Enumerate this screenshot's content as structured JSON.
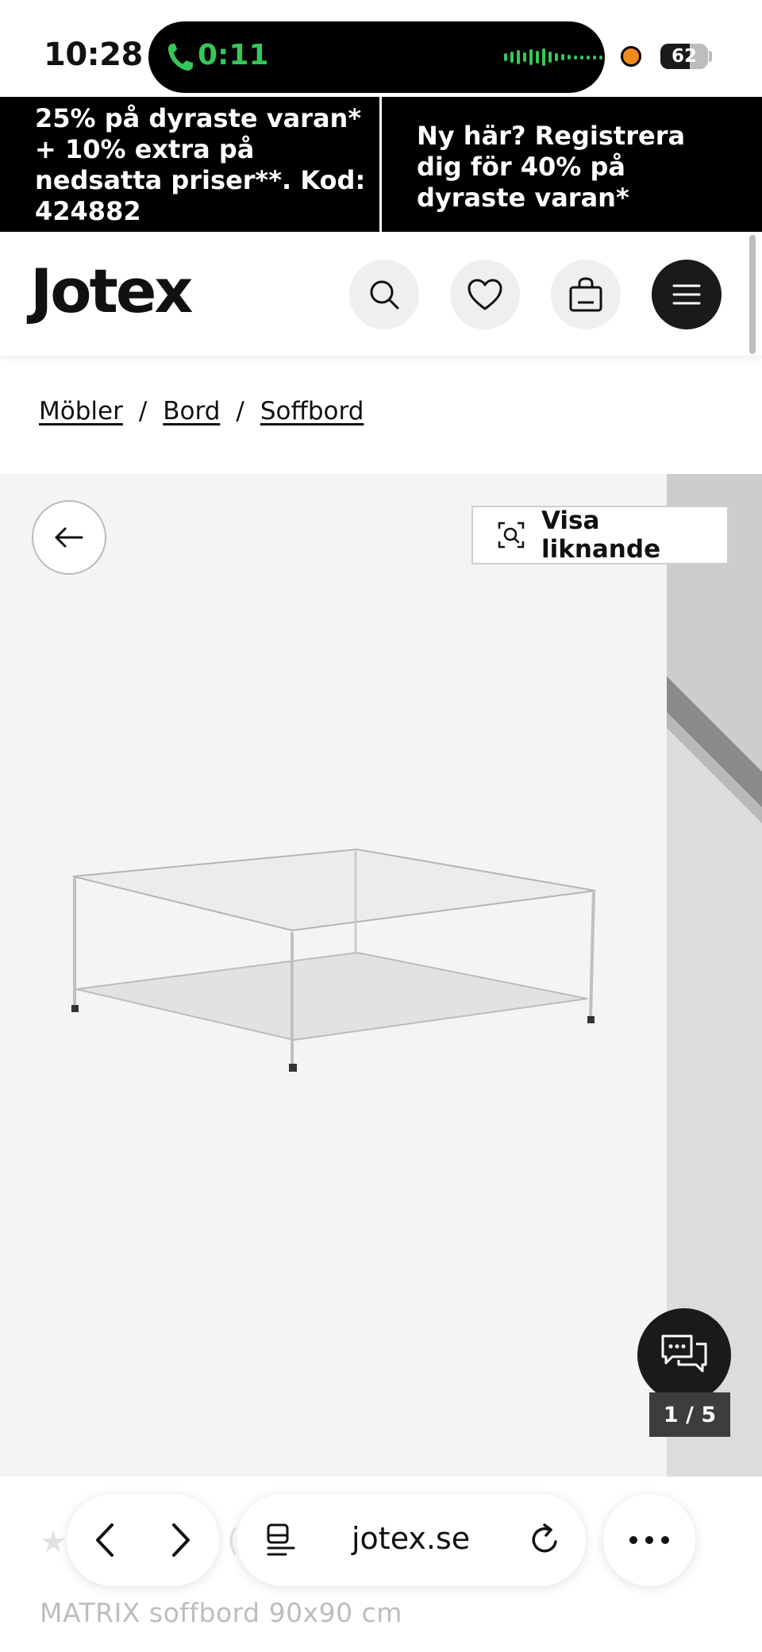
{
  "status_bar": {
    "time": "10:28",
    "call_duration": "0:11",
    "battery": "62",
    "battery_level": 0.62
  },
  "promo": {
    "left": "25% på dyraste varan* + 10% extra på nedsatta priser**. Kod: 424882",
    "right": "Ny här? Registrera dig för 40% på dyraste varan*"
  },
  "header": {
    "logo": "Jotex",
    "icons": [
      "search-icon",
      "heart-icon",
      "bag-icon",
      "menu-icon"
    ]
  },
  "breadcrumb": {
    "items": [
      "Möbler",
      "Bord",
      "Soffbord"
    ],
    "separator": "/"
  },
  "gallery": {
    "similar_label": "Visa liknande",
    "counter": "1 / 5"
  },
  "product": {
    "title": "MATRIX soffbord 90x90 cm",
    "rating_star": "★",
    "partial_text": "("
  },
  "browser": {
    "url": "jotex.se"
  },
  "colors": {
    "promo_bg": "#000000",
    "gallery_bg": "#f4f4f4",
    "call_green": "#34c759",
    "dark_button": "#1a1a1a"
  }
}
